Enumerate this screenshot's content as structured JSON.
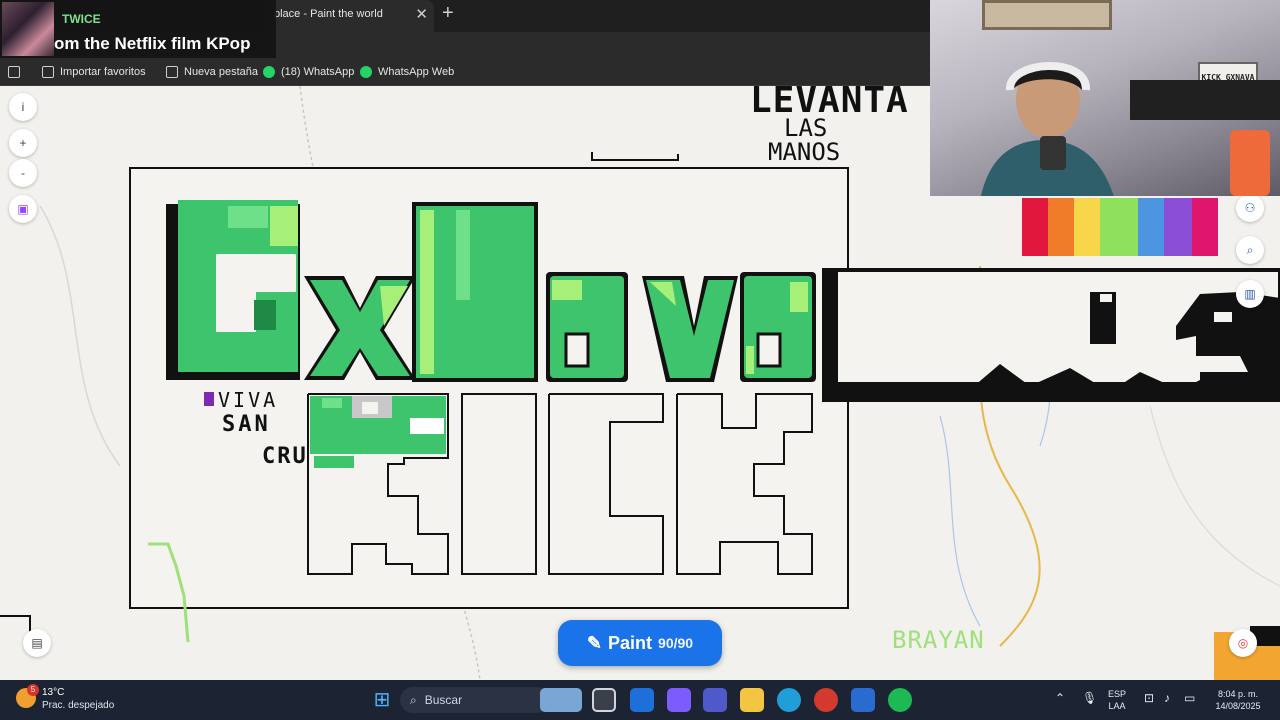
{
  "overlay": {
    "artist": "TWICE",
    "song": "om the Netflix film KPop"
  },
  "browser": {
    "tab_title": "place - Paint the world",
    "tab_close": "✕",
    "new_tab": "+",
    "bookmarks": [
      {
        "label": "Importar favoritos"
      },
      {
        "label": "Nueva pestaña"
      },
      {
        "label": "(18) WhatsApp"
      },
      {
        "label": "WhatsApp Web"
      }
    ]
  },
  "canvas": {
    "art_texts": {
      "levanta": "LEVANTA",
      "las": "LAS",
      "manos": "MANOS",
      "viva": "VIVA",
      "san": "SAN",
      "cru": "CRU",
      "brayan": "BRAYAN"
    },
    "sidebar": [
      "i",
      "+",
      "-"
    ],
    "paint_button": {
      "label": "Paint",
      "count": "90/90"
    },
    "palette": [
      "#e2173d",
      "#f07c2a",
      "#f7d64a",
      "#8fe05a",
      "#4c95e0",
      "#8a4fd6",
      "#e0156e"
    ],
    "brand_green": "#3ec46d"
  },
  "webcam": {
    "sign": "KICK GXNAVA"
  },
  "taskbar": {
    "weather": {
      "temp": "13°C",
      "condition": "Prac. despejado",
      "badge": "5"
    },
    "search_placeholder": "Buscar",
    "lang": "ESP",
    "lang2": "LAA",
    "time": "8:04 p. m.",
    "date": "14/08/2025"
  }
}
